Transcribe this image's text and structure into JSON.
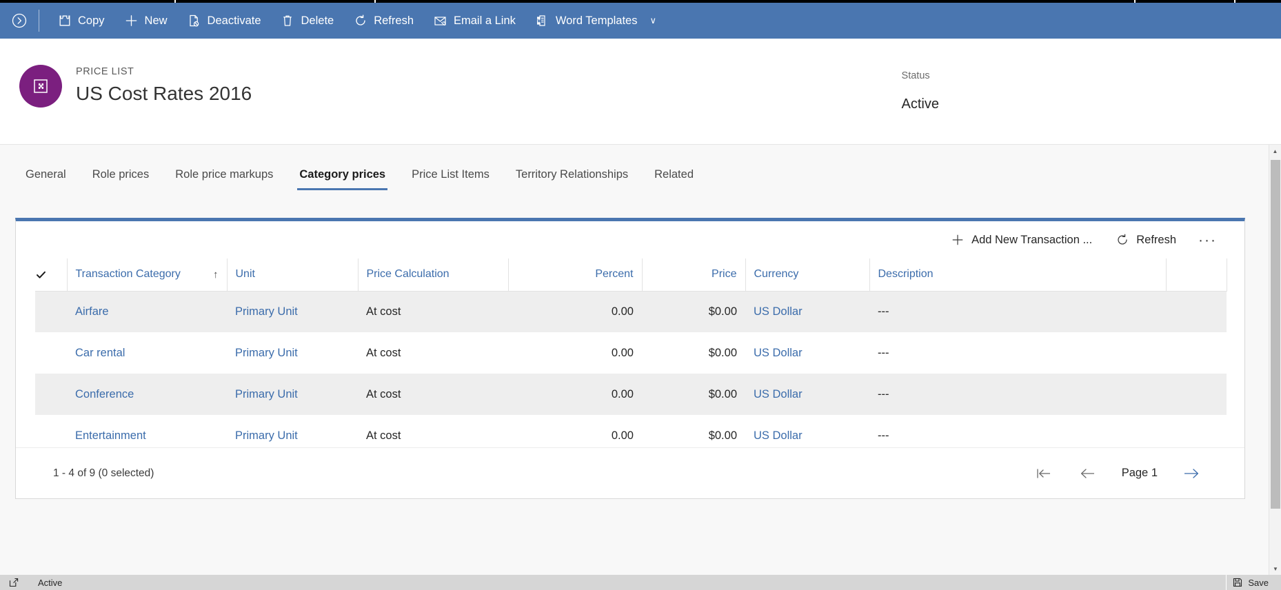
{
  "command_bar": {
    "expand_icon": "chevron-right-circle-icon",
    "items": [
      {
        "label": "Copy",
        "icon": "puzzle-icon"
      },
      {
        "label": "New",
        "icon": "plus-icon"
      },
      {
        "label": "Deactivate",
        "icon": "document-block-icon"
      },
      {
        "label": "Delete",
        "icon": "trash-icon"
      },
      {
        "label": "Refresh",
        "icon": "refresh-icon"
      },
      {
        "label": "Email a Link",
        "icon": "email-link-icon"
      },
      {
        "label": "Word Templates",
        "icon": "word-document-icon",
        "caret": "∨"
      }
    ],
    "accent_color": "#4a76b0"
  },
  "record_header": {
    "entity_type": "PRICE LIST",
    "title": "US Cost Rates 2016",
    "avatar_icon": "price-list-icon",
    "avatar_color": "#7b1f7f",
    "status_label": "Status",
    "status_value": "Active"
  },
  "tabs": [
    {
      "label": "General",
      "active": false
    },
    {
      "label": "Role prices",
      "active": false
    },
    {
      "label": "Role price markups",
      "active": false
    },
    {
      "label": "Category prices",
      "active": true
    },
    {
      "label": "Price List Items",
      "active": false
    },
    {
      "label": "Territory Relationships",
      "active": false
    },
    {
      "label": "Related",
      "active": false
    }
  ],
  "grid": {
    "toolbar": {
      "add_label": "Add New Transaction ...",
      "add_icon": "plus-icon",
      "refresh_label": "Refresh",
      "refresh_icon": "refresh-icon",
      "overflow_label": "···"
    },
    "select_all_icon": "checkmark-icon",
    "sort_arrow": "↑",
    "columns": [
      {
        "label": "Transaction Category",
        "align": "left",
        "sorted": true
      },
      {
        "label": "Unit",
        "align": "left",
        "sorted": false
      },
      {
        "label": "Price Calculation",
        "align": "left",
        "sorted": false
      },
      {
        "label": "Percent",
        "align": "right",
        "sorted": false
      },
      {
        "label": "Price",
        "align": "right",
        "sorted": false
      },
      {
        "label": "Currency",
        "align": "left",
        "sorted": false
      },
      {
        "label": "Description",
        "align": "left",
        "sorted": false
      }
    ],
    "rows": [
      {
        "transaction_category": "Airfare",
        "unit": "Primary Unit",
        "price_calculation": "At cost",
        "percent": "0.00",
        "price": "$0.00",
        "currency": "US Dollar",
        "description": "---"
      },
      {
        "transaction_category": "Car rental",
        "unit": "Primary Unit",
        "price_calculation": "At cost",
        "percent": "0.00",
        "price": "$0.00",
        "currency": "US Dollar",
        "description": "---"
      },
      {
        "transaction_category": "Conference",
        "unit": "Primary Unit",
        "price_calculation": "At cost",
        "percent": "0.00",
        "price": "$0.00",
        "currency": "US Dollar",
        "description": "---"
      },
      {
        "transaction_category": "Entertainment",
        "unit": "Primary Unit",
        "price_calculation": "At cost",
        "percent": "0.00",
        "price": "$0.00",
        "currency": "US Dollar",
        "description": "---"
      }
    ],
    "pager": {
      "count_text": "1 - 4 of 9 (0 selected)",
      "page_label": "Page 1",
      "first_icon": "first-page-icon",
      "prev_icon": "previous-page-icon",
      "next_icon": "next-page-icon"
    }
  },
  "status_bar": {
    "state_icon": "popout-icon",
    "state_label": "Active",
    "save_icon": "save-icon",
    "save_label": "Save"
  }
}
